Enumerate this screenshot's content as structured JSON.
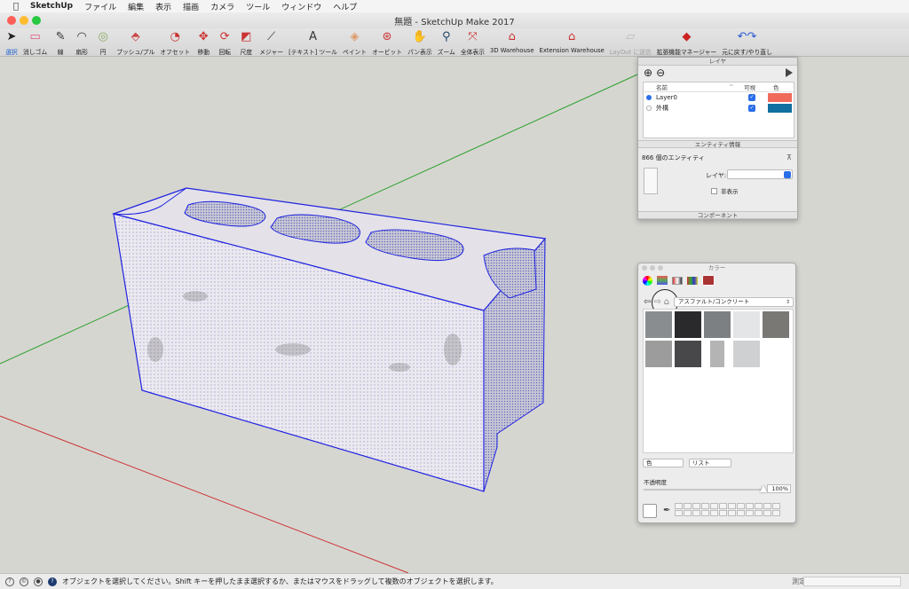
{
  "menubar": {
    "apple": "",
    "items": [
      "SketchUp",
      "ファイル",
      "編集",
      "表示",
      "描画",
      "カメラ",
      "ツール",
      "ウィンドウ",
      "ヘルプ"
    ]
  },
  "window": {
    "title": "無題 - SketchUp Make 2017"
  },
  "toolbar": {
    "tools": [
      {
        "label": "選択",
        "icon": "cursor-icon",
        "glyph": "➤",
        "active": true
      },
      {
        "label": "消しゴム",
        "icon": "eraser-icon",
        "glyph": "▭"
      },
      {
        "label": "線",
        "icon": "pencil-icon",
        "glyph": "✎"
      },
      {
        "label": "扇形",
        "icon": "arc-icon",
        "glyph": "◠"
      },
      {
        "label": "円",
        "icon": "circle-icon",
        "glyph": "◎"
      },
      {
        "label": "プッシュ/プル",
        "icon": "push-pull-icon",
        "glyph": "⬘"
      },
      {
        "label": "オフセット",
        "icon": "offset-icon",
        "glyph": "◔"
      },
      {
        "label": "移動",
        "icon": "move-icon",
        "glyph": "✥"
      },
      {
        "label": "回転",
        "icon": "rotate-icon",
        "glyph": "⟳"
      },
      {
        "label": "尺度",
        "icon": "scale-icon",
        "glyph": "◩"
      },
      {
        "label": "メジャー",
        "icon": "tape-measure-icon",
        "glyph": "⟋"
      },
      {
        "label": "[テキスト] ツール",
        "icon": "text-tool-icon",
        "glyph": "A"
      },
      {
        "label": "ペイント",
        "icon": "paint-bucket-icon",
        "glyph": "◈"
      },
      {
        "label": "オービット",
        "icon": "orbit-icon",
        "glyph": "⊛"
      },
      {
        "label": "パン表示",
        "icon": "pan-hand-icon",
        "glyph": "✋"
      },
      {
        "label": "ズーム",
        "icon": "zoom-icon",
        "glyph": "⚲"
      },
      {
        "label": "全体表示",
        "icon": "zoom-extents-icon",
        "glyph": "⤧"
      },
      {
        "label": "3D Warehouse",
        "icon": "warehouse-icon",
        "glyph": "⌂"
      },
      {
        "label": "Extension Warehouse",
        "icon": "extension-warehouse-icon",
        "glyph": "⌂"
      },
      {
        "label": "LayOut に送信",
        "icon": "layout-send-icon",
        "glyph": "▱",
        "disabled": true
      },
      {
        "label": "拡張機能マネージャー",
        "icon": "extension-manager-icon",
        "glyph": "◆"
      },
      {
        "label": "元に戻す/やり直し",
        "icon": "undo-redo-icon",
        "glyph": "↶↷"
      }
    ]
  },
  "layers_panel": {
    "title": "レイヤ",
    "add_icon": "⊕",
    "remove_icon": "⊖",
    "col_name": "名前",
    "col_visible": "可視",
    "col_color": "色",
    "layers": [
      {
        "name": "Layer0",
        "active": true,
        "visible": true,
        "color": "#f06a5c"
      },
      {
        "name": "外構",
        "active": false,
        "visible": true,
        "color": "#1170a0"
      }
    ]
  },
  "entity_info": {
    "title": "エンティティ情報",
    "count_text": "866 個のエンティティ",
    "layer_label": "レイヤ:",
    "layer_value": "",
    "hidden_label": "非表示"
  },
  "components_header": "コンポーネント",
  "color_panel": {
    "title": "カラー",
    "category": "アスファルト/コンクリート",
    "swatches": [
      "#8a8d8f",
      "#2a2a2c",
      "#7d8083",
      "#e4e5e6",
      "#7a7874",
      "#9c9c9c",
      "#48484b",
      "#b4b4b4",
      "#cfd0d2"
    ],
    "mode_select": "色",
    "view_select": "リスト",
    "opacity_label": "不透明度",
    "opacity_value": "100%",
    "opacity": 1.0
  },
  "statusbar": {
    "message": "オブジェクトを選択してください。Shift キーを押したまま選択するか、またはマウスをドラッグして複数のオブジェクトを選択します。",
    "measure_label": "測定"
  },
  "colors": {
    "selection_blue": "#1f22e0",
    "axis_green": "#2aa02a",
    "axis_red": "#cc3030",
    "block_face": "#eceaee"
  }
}
